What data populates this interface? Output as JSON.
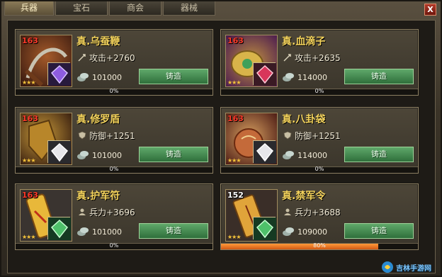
{
  "tabs": [
    {
      "label": "兵器",
      "active": true
    },
    {
      "label": "宝石",
      "active": false
    },
    {
      "label": "商会",
      "active": false
    },
    {
      "label": "器械",
      "active": false
    }
  ],
  "close_label": "X",
  "forge_label": "铸造",
  "items": [
    {
      "level": "163",
      "name": "真.乌蚕鞭",
      "stat": "攻击+2760",
      "stat_icon": "sword-icon",
      "cost": "101000",
      "progress_text": "0%",
      "progress": 0,
      "gem": "purple-gem",
      "level_color": "#ff3a2a"
    },
    {
      "level": "163",
      "name": "真.血滴子",
      "stat": "攻击+2635",
      "stat_icon": "sword-icon",
      "cost": "114000",
      "progress_text": "0%",
      "progress": 0,
      "gem": "red-gem",
      "level_color": "#ff3a2a"
    },
    {
      "level": "163",
      "name": "真.修罗盾",
      "stat": "防御+1251",
      "stat_icon": "shield-icon",
      "cost": "101000",
      "progress_text": "0%",
      "progress": 0,
      "gem": "white-gem",
      "level_color": "#ff3a2a"
    },
    {
      "level": "163",
      "name": "真.八卦袋",
      "stat": "防御+1251",
      "stat_icon": "shield-icon",
      "cost": "114000",
      "progress_text": "0%",
      "progress": 0,
      "gem": "white-gem",
      "level_color": "#ff3a2a"
    },
    {
      "level": "163",
      "name": "真.护军符",
      "stat": "兵力+3696",
      "stat_icon": "soldier-icon",
      "cost": "101000",
      "progress_text": "0%",
      "progress": 0,
      "gem": "green-gem",
      "level_color": "#ff3a2a"
    },
    {
      "level": "152",
      "name": "真.禁军令",
      "stat": "兵力+3688",
      "stat_icon": "soldier-icon",
      "cost": "109000",
      "progress_text": "80%",
      "progress": 0.8,
      "gem": "green-gem",
      "level_color": "#ffffff"
    }
  ],
  "watermark": "吉林手游网"
}
